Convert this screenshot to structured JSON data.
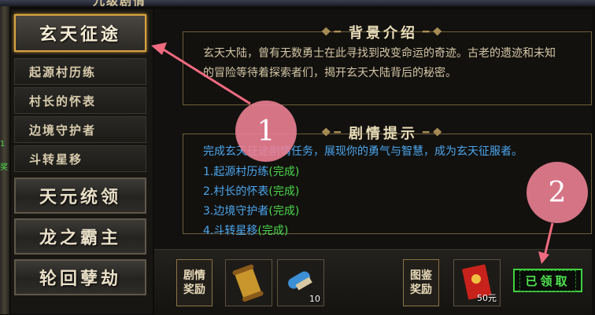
{
  "window": {
    "title": "九级剧情",
    "side_text_1": "1",
    "side_text_2": "奖"
  },
  "nav": {
    "main_active": "玄天征途",
    "sub_items": [
      "起源村历练",
      "村长的怀表",
      "边境守护者",
      "斗转星移"
    ],
    "main_items": [
      "天元统领",
      "龙之霸主",
      "轮回孽劫"
    ]
  },
  "background_panel": {
    "title": "背景介绍",
    "text": "玄天大陆，曾有无数勇士在此寻找到改变命运的奇迹。古老的遗迹和未知的冒险等待着探索者们，揭开玄天大陆背后的秘密。"
  },
  "hint_panel": {
    "title": "剧情提示",
    "intro": "完成玄天征途剧情任务，展现你的勇气与智慧，成为玄天征服者。",
    "quests": [
      {
        "name": "1.起源村历练",
        "status": "(完成)"
      },
      {
        "name": "2.村长的怀表",
        "status": "(完成)"
      },
      {
        "name": "3.边境守护者",
        "status": "(完成)"
      },
      {
        "name": "4.斗转星移",
        "status": "(完成)"
      }
    ]
  },
  "bottom_bar": {
    "story_reward_line1": "剧情",
    "story_reward_line2": "奖励",
    "item1_icon": "scroll-icon",
    "item2_icon": "rolled-scroll-icon",
    "item2_count": "10",
    "atlas_reward_line1": "图鉴",
    "atlas_reward_line2": "奖励",
    "item3_icon": "red-envelope-icon",
    "item3_count": "50元",
    "claimed_label": "已领取"
  },
  "annotations": {
    "marker1": "1",
    "marker2": "2"
  },
  "colors": {
    "accent_gold": "#d9a441",
    "quest_blue": "#4aa6ee",
    "complete_green": "#4ad84a",
    "marker_pink": "#f08296"
  }
}
